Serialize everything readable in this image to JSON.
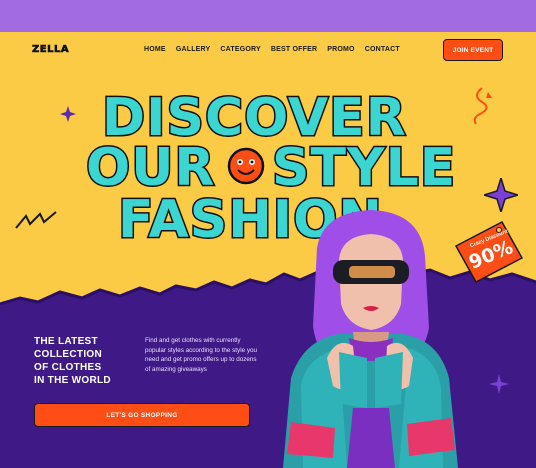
{
  "brand": {
    "logo_text": "ZELLA"
  },
  "nav": {
    "items": [
      {
        "label": "HOME"
      },
      {
        "label": "GALLERY"
      },
      {
        "label": "CATEGORY"
      },
      {
        "label": "BEST OFFER"
      },
      {
        "label": "PROMO"
      },
      {
        "label": "CONTACT"
      }
    ],
    "join_label": "JOIN EVENT"
  },
  "hero": {
    "headline_line1": "DISCOVER",
    "headline_line2a": "OUR",
    "headline_line2b": "STYLE",
    "headline_line3": "FASHION",
    "tagline_lines": [
      "THE LATEST",
      "COLLECTION",
      "OF CLOTHES",
      "IN THE WORLD"
    ],
    "description": "Find and get clothes with currently popular styles according to the style you need and get promo offers up to dozens of amazing giveaways",
    "cta_label": "LET'S GO SHOPPING"
  },
  "discount_tag": {
    "small_text": "Crazy Discount",
    "big_text": "90%"
  },
  "colors": {
    "top_strip": "#a36be0",
    "hero_bg": "#fbcb45",
    "headline_fill": "#3cd6d2",
    "bottom_bg": "#3f1a86",
    "accent": "#ff4d16"
  },
  "icons": [
    "sparkle-icon",
    "squiggle-icon",
    "zigzag-icon",
    "smiley-icon",
    "price-tag-icon"
  ]
}
